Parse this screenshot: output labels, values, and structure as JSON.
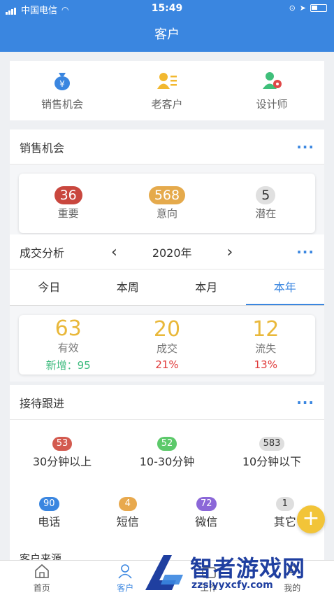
{
  "status_bar": {
    "carrier": "中国电信",
    "time": "15:49"
  },
  "header": {
    "title": "客户"
  },
  "top_categories": [
    {
      "label": "销售机会",
      "icon": "money-bag-icon"
    },
    {
      "label": "老客户",
      "icon": "contact-card-icon"
    },
    {
      "label": "设计师",
      "icon": "designer-icon"
    }
  ],
  "sales": {
    "title": "销售机会",
    "stats": [
      {
        "value": "36",
        "label": "重要",
        "color": "#c9473e"
      },
      {
        "value": "568",
        "label": "意向",
        "color": "#e5aa4c"
      },
      {
        "value": "5",
        "label": "潜在",
        "color": "#e0e0e0"
      }
    ]
  },
  "analysis": {
    "title": "成交分析",
    "year": "2020年",
    "tabs": [
      "今日",
      "本周",
      "本月",
      "本年"
    ],
    "active_tab": 3,
    "deals": [
      {
        "value": "63",
        "label": "有效",
        "sub": "新增：95",
        "sub_color": "#3dbb7e"
      },
      {
        "value": "20",
        "label": "成交",
        "sub": "21%",
        "sub_color": "#e03b3b"
      },
      {
        "value": "12",
        "label": "流失",
        "sub": "13%",
        "sub_color": "#e03b3b"
      }
    ]
  },
  "followup": {
    "title": "接待跟进",
    "row1": [
      {
        "value": "53",
        "label": "30分钟以上",
        "color": "#d35a4f"
      },
      {
        "value": "52",
        "label": "10-30分钟",
        "color": "#5cc96a"
      },
      {
        "value": "583",
        "label": "10分钟以下",
        "color": "#dedede"
      }
    ],
    "row2": [
      {
        "value": "90",
        "label": "电话",
        "color": "#3a86e0"
      },
      {
        "value": "4",
        "label": "短信",
        "color": "#e8a94e"
      },
      {
        "value": "72",
        "label": "微信",
        "color": "#8b67d8"
      },
      {
        "value": "1",
        "label": "其它",
        "color": "#dedede"
      }
    ]
  },
  "source_title": "客户来源",
  "tabbar": [
    {
      "label": "首页",
      "icon": "home-icon"
    },
    {
      "label": "客户",
      "icon": "user-icon"
    },
    {
      "label": "工作",
      "icon": "work-icon"
    },
    {
      "label": "我的",
      "icon": "profile-icon"
    }
  ],
  "watermark": {
    "title": "智者游戏网",
    "url": "zzslyyxcfy.com"
  }
}
